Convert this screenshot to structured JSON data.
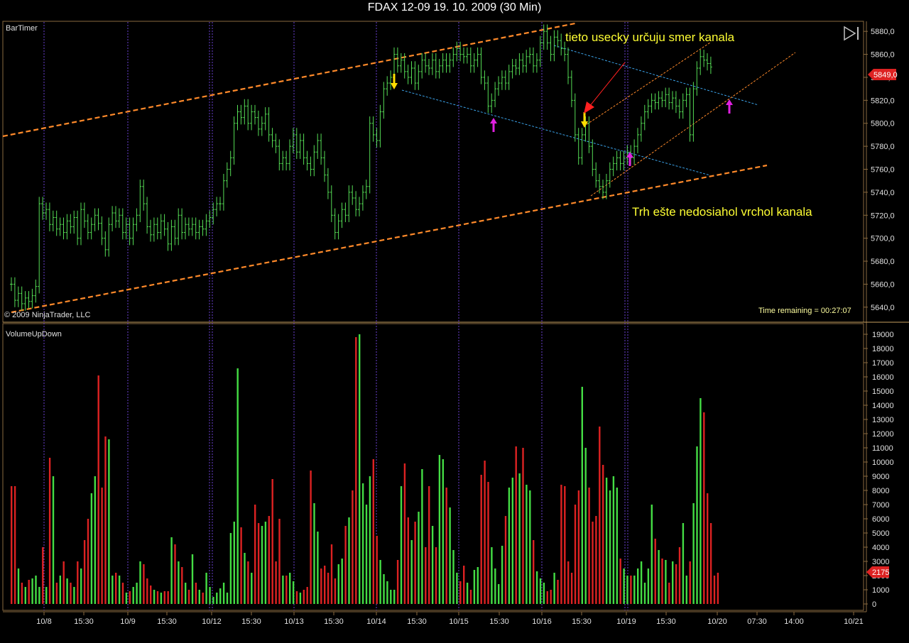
{
  "window": {
    "title": "FDAX 12-09  19. 10. 2009 (30 Min)"
  },
  "colors": {
    "background": "#000000",
    "frame": "#c8a060",
    "bar_up": "#44dd44",
    "bar_down": "#dd2222",
    "price_bar": "#55dd55",
    "session_line": "#6a3fd0",
    "channel_main": "#ff8a2a",
    "channel_thin": "#ff8a2a",
    "trend_blue": "#3aa0e6",
    "annotation_text": "#ffff33",
    "arrow_yellow": "#ffdd00",
    "arrow_magenta": "#e020e0",
    "arrow_red": "#ff2020",
    "price_marker": "#dd2222"
  },
  "price_panel": {
    "label": "BarTimer",
    "copyright": "© 2009 NinjaTrader, LLC",
    "time_remaining": "Time remaining = 00:27:07",
    "y_ticks": [
      "5880,0",
      "5860,0",
      "5840,0",
      "5820,0",
      "5800,0",
      "5780,0",
      "5760,0",
      "5740,0",
      "5720,0",
      "5700,0",
      "5680,0",
      "5660,0",
      "5640,0"
    ],
    "current_price": "5849,0",
    "annotations": {
      "direction": "tieto usecky určuju smer kanala",
      "market": "Trh ešte nedosiahol vrchol kanala"
    }
  },
  "volume_panel": {
    "label": "VolumeUpDown",
    "y_ticks": [
      "19000",
      "18000",
      "17000",
      "16000",
      "15000",
      "14000",
      "13000",
      "12000",
      "11000",
      "10000",
      "9000",
      "8000",
      "7000",
      "6000",
      "5000",
      "4000",
      "3000",
      "2000",
      "1000",
      "0"
    ],
    "current_volume": "2175"
  },
  "x_axis": {
    "labels": [
      "10/8",
      "15:30",
      "10/9",
      "15:30",
      "10/12",
      "15:30",
      "10/13",
      "15:30",
      "10/14",
      "15:30",
      "10/15",
      "15:30",
      "10/16",
      "15:30",
      "10/19",
      "15:30",
      "10/20",
      "07:30",
      "14:00",
      "10/21"
    ]
  },
  "chart_data": {
    "type": "bar",
    "title": "FDAX 12-09  19. 10. 2009 (30 Min)",
    "price_range": [
      5630,
      5890
    ],
    "volume_range": [
      0,
      19500
    ],
    "sessions": [
      "10/8",
      "10/9",
      "10/12",
      "10/13",
      "10/14",
      "10/15",
      "10/16",
      "10/19"
    ],
    "price_close": [
      5660,
      5646,
      5652,
      5643,
      5648,
      5645,
      5650,
      5658,
      5730,
      5722,
      5725,
      5712,
      5718,
      5708,
      5712,
      5705,
      5715,
      5710,
      5718,
      5700,
      5725,
      5715,
      5705,
      5712,
      5720,
      5713,
      5700,
      5690,
      5712,
      5722,
      5715,
      5720,
      5705,
      5712,
      5700,
      5712,
      5720,
      5745,
      5730,
      5710,
      5703,
      5712,
      5705,
      5715,
      5708,
      5695,
      5710,
      5700,
      5720,
      5705,
      5712,
      5708,
      5712,
      5705,
      5710,
      5708,
      5715,
      5718,
      5725,
      5730,
      5730,
      5750,
      5760,
      5770,
      5800,
      5810,
      5805,
      5815,
      5800,
      5810,
      5805,
      5795,
      5800,
      5808,
      5790,
      5785,
      5780,
      5765,
      5770,
      5765,
      5780,
      5790,
      5775,
      5785,
      5770,
      5765,
      5760,
      5775,
      5785,
      5770,
      5755,
      5740,
      5720,
      5705,
      5715,
      5725,
      5720,
      5740,
      5735,
      5725,
      5730,
      5740,
      5745,
      5800,
      5790,
      5785,
      5810,
      5830,
      5835,
      5840,
      5860,
      5850,
      5855,
      5845,
      5840,
      5848,
      5835,
      5845,
      5855,
      5850,
      5848,
      5855,
      5845,
      5850,
      5855,
      5850,
      5855,
      5860,
      5865,
      5860,
      5858,
      5860,
      5850,
      5855,
      5860,
      5840,
      5835,
      5815,
      5820,
      5830,
      5835,
      5840,
      5835,
      5845,
      5850,
      5848,
      5855,
      5850,
      5858,
      5860,
      5850,
      5855,
      5870,
      5880,
      5870,
      5860,
      5875,
      5872,
      5865,
      5860,
      5840,
      5820,
      5790,
      5770,
      5790,
      5800,
      5780,
      5760,
      5750,
      5745,
      5740,
      5750,
      5760,
      5765,
      5770,
      5765,
      5770,
      5775,
      5770,
      5780,
      5790,
      5800,
      5810,
      5815,
      5820,
      5818,
      5822,
      5820,
      5825,
      5818,
      5822,
      5815,
      5810,
      5820,
      5825,
      5790,
      5830,
      5848,
      5858,
      5855,
      5852,
      5849
    ],
    "volume_values": [
      8300,
      8300,
      2500,
      1500,
      1200,
      1700,
      1800,
      2000,
      1200,
      4000,
      1200,
      10300,
      9000,
      1500,
      2000,
      3000,
      1800,
      1500,
      1200,
      3000,
      2500,
      4500,
      6000,
      7800,
      9000,
      16100,
      8200,
      11800,
      11600,
      2000,
      2200,
      2000,
      1500,
      800,
      900,
      1200,
      1500,
      3000,
      2800,
      1800,
      1300,
      1000,
      900,
      800,
      900,
      900,
      4700,
      4200,
      3000,
      2600,
      1500,
      1000,
      3500,
      1500,
      1000,
      800,
      2200,
      1200,
      500,
      800,
      1100,
      1500,
      800,
      5000,
      5800,
      16600,
      5400,
      3600,
      3000,
      2200,
      7000,
      5700,
      5500,
      5800,
      6200,
      8800,
      3000,
      6000,
      2000,
      2000,
      2200,
      1600,
      900,
      800,
      1000,
      1200,
      9400,
      7100,
      5100,
      2500,
      2700,
      2200,
      4200,
      1800,
      2800,
      3200,
      5500,
      6100,
      8000,
      18800,
      19000,
      8500,
      7000,
      9000,
      10200,
      4800,
      3100,
      2100,
      1600,
      1000,
      1000,
      3100,
      8300,
      9900,
      6100,
      4500,
      5800,
      6500,
      9500,
      4000,
      8300,
      5500,
      4000,
      10500,
      10200,
      8200,
      6800,
      3800,
      2200,
      1600,
      2700,
      1500,
      1000,
      2400,
      2600,
      9100,
      10100,
      8600,
      4000,
      2500,
      1400,
      4100,
      6200,
      8200,
      8900,
      11100,
      9200,
      11000,
      8400,
      8000,
      4500,
      2300,
      1800,
      1500,
      900,
      1000,
      2200,
      1700,
      8400,
      8300,
      3000,
      2200,
      7000,
      8000,
      15300,
      11000,
      8200,
      5800,
      6200,
      12500,
      9800,
      8900,
      8000,
      9000,
      8200,
      3200,
      2500,
      2000,
      2000,
      2000,
      2500,
      3000,
      1500,
      2500,
      7000,
      4600,
      3800,
      3200,
      3100,
      1500,
      3000,
      2800,
      4000,
      5700,
      2000,
      3000,
      7100,
      11100,
      14500,
      13500,
      7800,
      5700,
      2000,
      2200
    ]
  }
}
